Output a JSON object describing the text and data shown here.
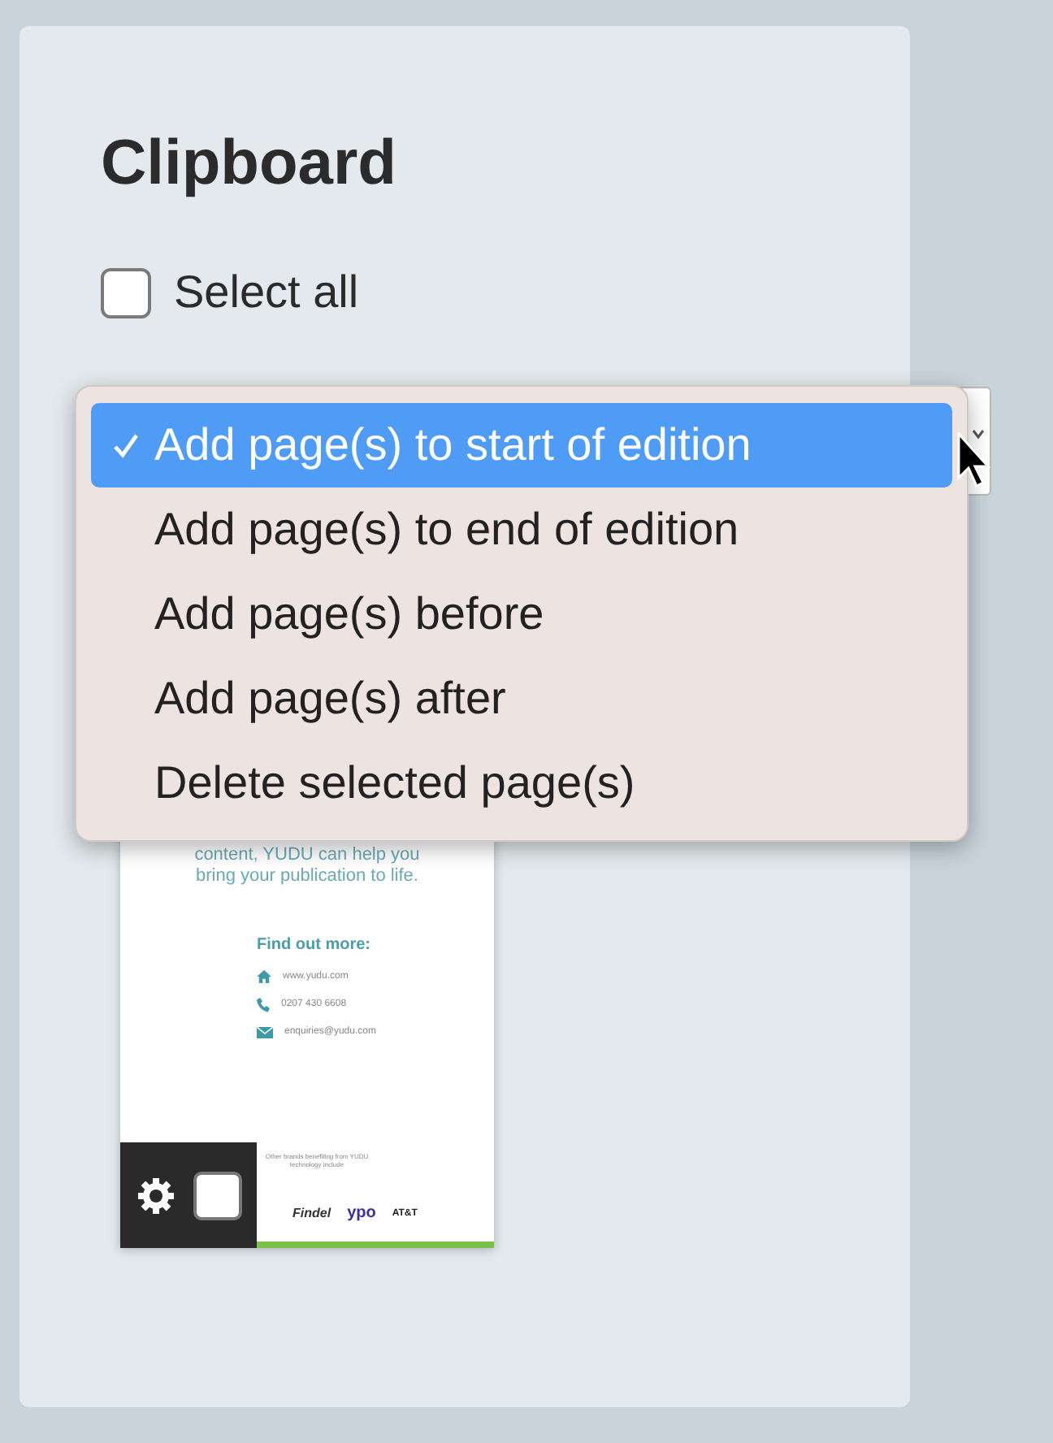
{
  "panel": {
    "title": "Clipboard",
    "select_all": {
      "label": "Select all",
      "checked": false
    }
  },
  "action_menu": {
    "items": [
      {
        "label": "Add page(s) to start of edition",
        "selected": true
      },
      {
        "label": "Add page(s) to end of edition",
        "selected": false
      },
      {
        "label": "Add page(s) before",
        "selected": false
      },
      {
        "label": "Add page(s) after",
        "selected": false
      },
      {
        "label": "Delete selected page(s)",
        "selected": false
      }
    ]
  },
  "page_thumbnail": {
    "body": [
      "content, YUDU can help you",
      "bring your publication to life."
    ],
    "heading": "Find out more:",
    "contacts": [
      {
        "kind": "web",
        "text": "www.yudu.com"
      },
      {
        "kind": "phone",
        "text": "0207 430 6608"
      },
      {
        "kind": "email",
        "text": "enquiries@yudu.com"
      }
    ],
    "footer": "Other brands benefiting from YUDU technology include",
    "brands": [
      "Findel",
      "ypo",
      "AT&T"
    ],
    "checked": false
  }
}
